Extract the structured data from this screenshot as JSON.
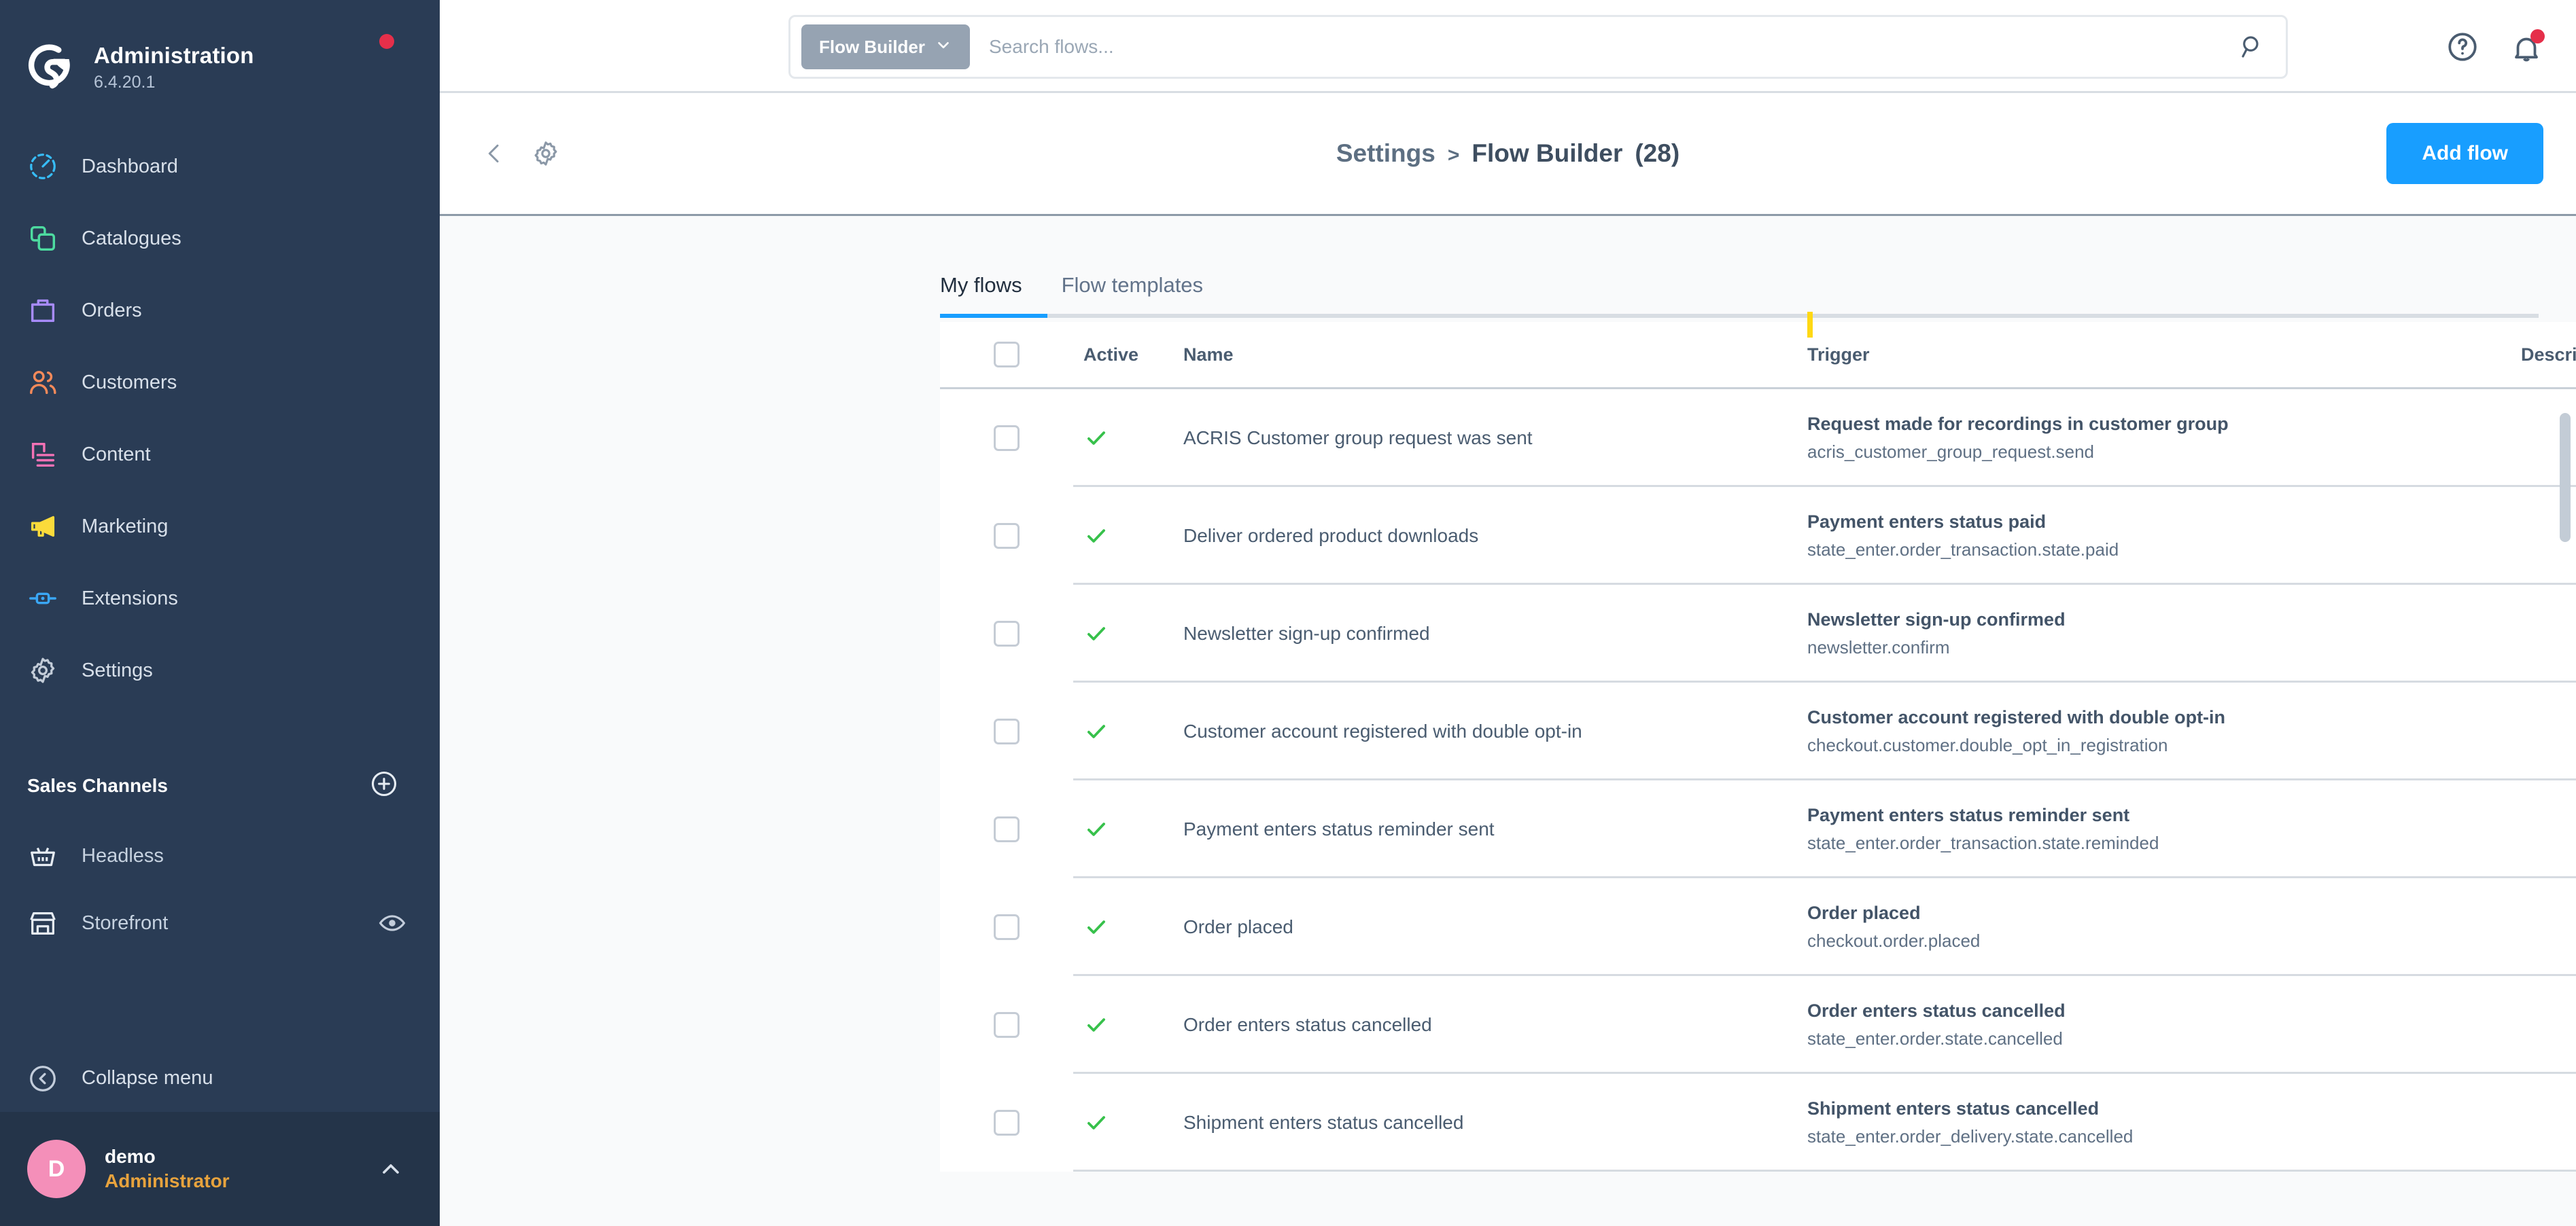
{
  "sidebar": {
    "brand": {
      "title": "Administration",
      "version": "6.4.20.1",
      "logo_icon": "shopware-logo-icon",
      "status_dot_color": "#e52f4a"
    },
    "nav": [
      {
        "label": "Dashboard",
        "icon": "dashboard-gauge-icon",
        "color": "#37bdf8"
      },
      {
        "label": "Catalogues",
        "icon": "catalogues-layers-icon",
        "color": "#4ddba0"
      },
      {
        "label": "Orders",
        "icon": "orders-bag-icon",
        "color": "#a78bfa"
      },
      {
        "label": "Customers",
        "icon": "customers-people-icon",
        "color": "#f58a5a"
      },
      {
        "label": "Content",
        "icon": "content-layout-icon",
        "color": "#f472b6"
      },
      {
        "label": "Marketing",
        "icon": "marketing-megaphone-icon",
        "color": "#fbdb3b"
      },
      {
        "label": "Extensions",
        "icon": "extensions-plug-icon",
        "color": "#3aa7f5"
      },
      {
        "label": "Settings",
        "icon": "settings-gear-icon",
        "color": "#c3ccd8"
      }
    ],
    "sales_channels": {
      "title": "Sales Channels",
      "add_icon": "plus-circle-icon",
      "items": [
        {
          "label": "Headless",
          "icon": "basket-icon",
          "trailing_icon": ""
        },
        {
          "label": "Storefront",
          "icon": "storefront-icon",
          "trailing_icon": "eye-icon"
        }
      ]
    },
    "collapse": {
      "label": "Collapse menu",
      "icon": "chevron-left-circle-icon"
    },
    "user": {
      "initial": "D",
      "name": "demo",
      "role": "Administrator",
      "caret_icon": "chevron-up-icon",
      "avatar_color": "#f48fb9",
      "role_color": "#e8a33d"
    }
  },
  "topbar": {
    "search": {
      "scope_label": "Flow Builder",
      "scope_caret_icon": "chevron-down-icon",
      "placeholder": "Search flows...",
      "value": "",
      "submit_icon": "search-icon"
    },
    "actions": [
      {
        "icon": "help-circle-icon",
        "name": "help-button"
      },
      {
        "icon": "bell-icon",
        "name": "notifications-button",
        "badge_color": "#e52f4a"
      }
    ]
  },
  "smartbar": {
    "back_icon": "chevron-left-icon",
    "settings_icon": "gear-icon",
    "breadcrumb": {
      "parent": "Settings",
      "separator": ">",
      "current": "Flow Builder",
      "count": "(28)"
    },
    "add_button": "Add flow",
    "add_button_color": "#189eff"
  },
  "content": {
    "tabs": [
      {
        "label": "My flows",
        "active": true
      },
      {
        "label": "Flow templates",
        "active": false
      }
    ],
    "active_tab_color": "#189eff",
    "column_marker_color": "#ffd814",
    "table": {
      "columns": [
        "",
        "Active",
        "Name",
        "Trigger",
        "Description"
      ],
      "select_all_checked": false,
      "row_menu_icon": "ellipsis-icon",
      "rows": [
        {
          "checked": false,
          "active": true,
          "active_icon": "check-icon",
          "name": "ACRIS Customer group request was sent",
          "trigger_title": "Request made for recordings in customer group",
          "trigger_key": "acris_customer_group_request.send",
          "description": ""
        },
        {
          "checked": false,
          "active": true,
          "active_icon": "check-icon",
          "name": "Deliver ordered product downloads",
          "trigger_title": "Payment enters status paid",
          "trigger_key": "state_enter.order_transaction.state.paid",
          "description": ""
        },
        {
          "checked": false,
          "active": true,
          "active_icon": "check-icon",
          "name": "Newsletter sign-up confirmed",
          "trigger_title": "Newsletter sign-up confirmed",
          "trigger_key": "newsletter.confirm",
          "description": ""
        },
        {
          "checked": false,
          "active": true,
          "active_icon": "check-icon",
          "name": "Customer account registered with double opt-in",
          "trigger_title": "Customer account registered with double opt-in",
          "trigger_key": "checkout.customer.double_opt_in_registration",
          "description": ""
        },
        {
          "checked": false,
          "active": true,
          "active_icon": "check-icon",
          "name": "Payment enters status reminder sent",
          "trigger_title": "Payment enters status reminder sent",
          "trigger_key": "state_enter.order_transaction.state.reminded",
          "description": ""
        },
        {
          "checked": false,
          "active": true,
          "active_icon": "check-icon",
          "name": "Order placed",
          "trigger_title": "Order placed",
          "trigger_key": "checkout.order.placed",
          "description": ""
        },
        {
          "checked": false,
          "active": true,
          "active_icon": "check-icon",
          "name": "Order enters status cancelled",
          "trigger_title": "Order enters status cancelled",
          "trigger_key": "state_enter.order.state.cancelled",
          "description": ""
        },
        {
          "checked": false,
          "active": true,
          "active_icon": "check-icon",
          "name": "Shipment enters status cancelled",
          "trigger_title": "Shipment enters status cancelled",
          "trigger_key": "state_enter.order_delivery.state.cancelled",
          "description": ""
        }
      ]
    }
  }
}
